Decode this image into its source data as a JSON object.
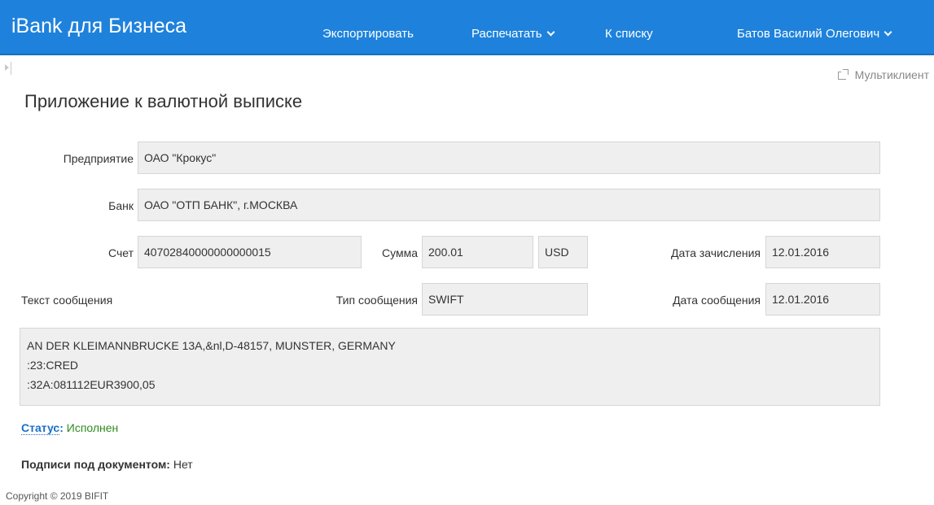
{
  "header": {
    "brand": "iBank для Бизнеса",
    "export_label": "Экспортировать",
    "print_label": "Распечатать",
    "to_list_label": "К списку",
    "user_name": "Батов Василий Олегович",
    "background_color": "#1e82dc"
  },
  "toolbar": {
    "multiclient_label": "Мультиклиент",
    "multiclient_icon": "external-link-icon",
    "sidebar_toggle_icon": "expand-sidebar-icon"
  },
  "page": {
    "title": "Приложение к валютной выписке"
  },
  "form": {
    "enterprise_label": "Предприятие",
    "enterprise_value": "ОАО \"Крокус\"",
    "bank_label": "Банк",
    "bank_value": "ОАО \"ОТП БАНК\", г.МОСКВА",
    "account_label": "Счет",
    "account_value": "40702840000000000015",
    "amount_label": "Сумма",
    "amount_value": "200.01",
    "currency_value": "USD",
    "credit_date_label": "Дата зачисления",
    "credit_date_value": "12.01.2016",
    "message_text_label": "Текст сообщения",
    "message_type_label": "Тип сообщения",
    "message_type_value": "SWIFT",
    "message_date_label": "Дата сообщения",
    "message_date_value": "12.01.2016",
    "message_lines": [
      "AN DER KLEIMANNBRUCKE 13A,&nl,D-48157, MUNSTER, GERMANY",
      ":23:CRED",
      ":32A:081112EUR3900,05"
    ]
  },
  "status": {
    "label": "Статус",
    "value": "Исполнен",
    "value_color": "#2e8b1e"
  },
  "signatures": {
    "label": "Подписи под документом:",
    "value": "Нет"
  },
  "footer": {
    "copyright": "Copyright © 2019 BIFIT"
  }
}
